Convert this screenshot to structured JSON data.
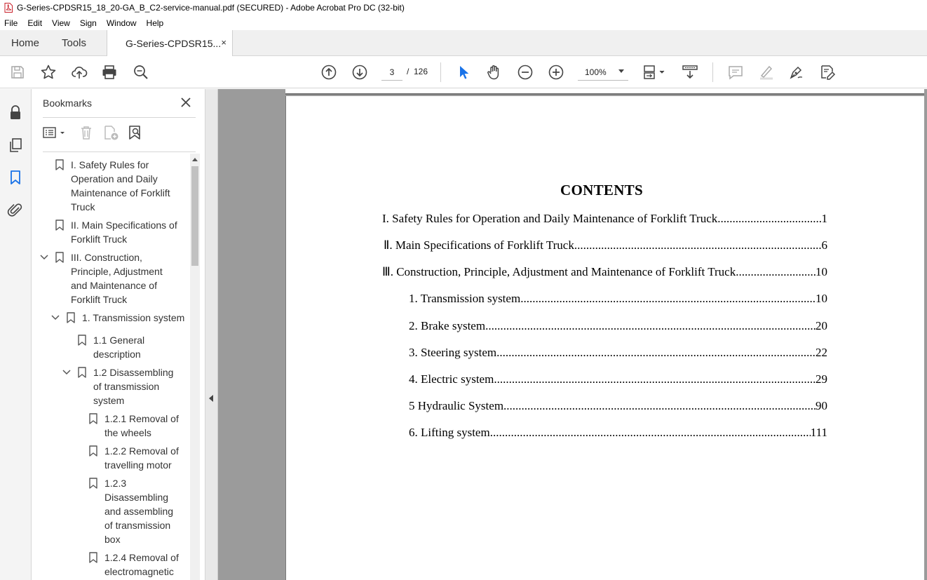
{
  "window": {
    "title": "G-Series-CPDSR15_18_20-GA_B_C2-service-manual.pdf (SECURED) - Adobe Acrobat Pro DC (32-bit)"
  },
  "menu": [
    "File",
    "Edit",
    "View",
    "Sign",
    "Window",
    "Help"
  ],
  "tabs": {
    "home": "Home",
    "tools": "Tools",
    "document": "G-Series-CPDSR15...",
    "close": "×"
  },
  "toolbar": {
    "page_current": "3",
    "page_separator": "/",
    "page_total": "126",
    "zoom": "100%"
  },
  "bookmarks": {
    "title": "Bookmarks",
    "items": [
      {
        "label": "I. Safety Rules for Operation and Daily Maintenance of Forklift Truck",
        "lines": [
          "I. Safety Rules for",
          "Operation and Daily",
          "Maintenance of Forklift",
          "Truck"
        ]
      },
      {
        "label": "II. Main Specifications of Forklift Truck",
        "lines": [
          "II. Main Specifications of",
          "Forklift Truck"
        ]
      },
      {
        "label": "III. Construction, Principle, Adjustment and Maintenance of Forklift Truck",
        "lines": [
          "III. Construction,",
          "Principle, Adjustment",
          "and Maintenance of",
          "Forklift Truck"
        ]
      },
      {
        "label": "1. Transmission system",
        "lines": [
          "1. Transmission system"
        ]
      },
      {
        "label": "1.1 General description",
        "lines": [
          "1.1 General",
          "description"
        ]
      },
      {
        "label": "1.2 Disassembling of transmission system",
        "lines": [
          "1.2 Disassembling",
          "of transmission",
          "system"
        ]
      },
      {
        "label": "1.2.1 Removal of the wheels",
        "lines": [
          "1.2.1 Removal of",
          "the wheels"
        ]
      },
      {
        "label": "1.2.2 Removal of travelling motor",
        "lines": [
          "1.2.2 Removal of",
          "travelling motor"
        ]
      },
      {
        "label": "1.2.3 Disassembling and assembling of transmission box",
        "lines": [
          "1.2.3",
          "Disassembling",
          "and assembling",
          "of transmission",
          "box"
        ]
      },
      {
        "label": "1.2.4 Removal of electromagnetic",
        "lines": [
          "1.2.4 Removal of",
          "electromagnetic"
        ]
      }
    ]
  },
  "document": {
    "heading": "CONTENTS",
    "toc": [
      {
        "text": "I. Safety Rules for Operation and Daily Maintenance of Forklift Truck ",
        "page": "1"
      },
      {
        "text": "Ⅱ. Main Specifications of Forklift Truck",
        "page": "6"
      },
      {
        "text": "Ⅲ. Construction, Principle, Adjustment and Maintenance of Forklift Truck",
        "page": "10"
      },
      {
        "text": "1. Transmission system ",
        "page": "10"
      },
      {
        "text": "2. Brake system",
        "page": "20"
      },
      {
        "text": "3. Steering system ",
        "page": "22"
      },
      {
        "text": "4. Electric system ",
        "page": "29"
      },
      {
        "text": "5 Hydraulic System",
        "page": "90"
      },
      {
        "text": "6. Lifting system ",
        "page": "111"
      }
    ]
  },
  "icons": {
    "save": "save-icon",
    "star": "star-icon",
    "upload": "cloud-upload-icon",
    "print": "print-icon",
    "zoom_search": "zoom-search-icon",
    "prev_page": "prev-page-icon",
    "next_page": "next-page-icon",
    "select": "select-arrow-icon",
    "hand": "hand-icon",
    "zoom_out": "zoom-out-icon",
    "zoom_in": "zoom-in-icon"
  }
}
